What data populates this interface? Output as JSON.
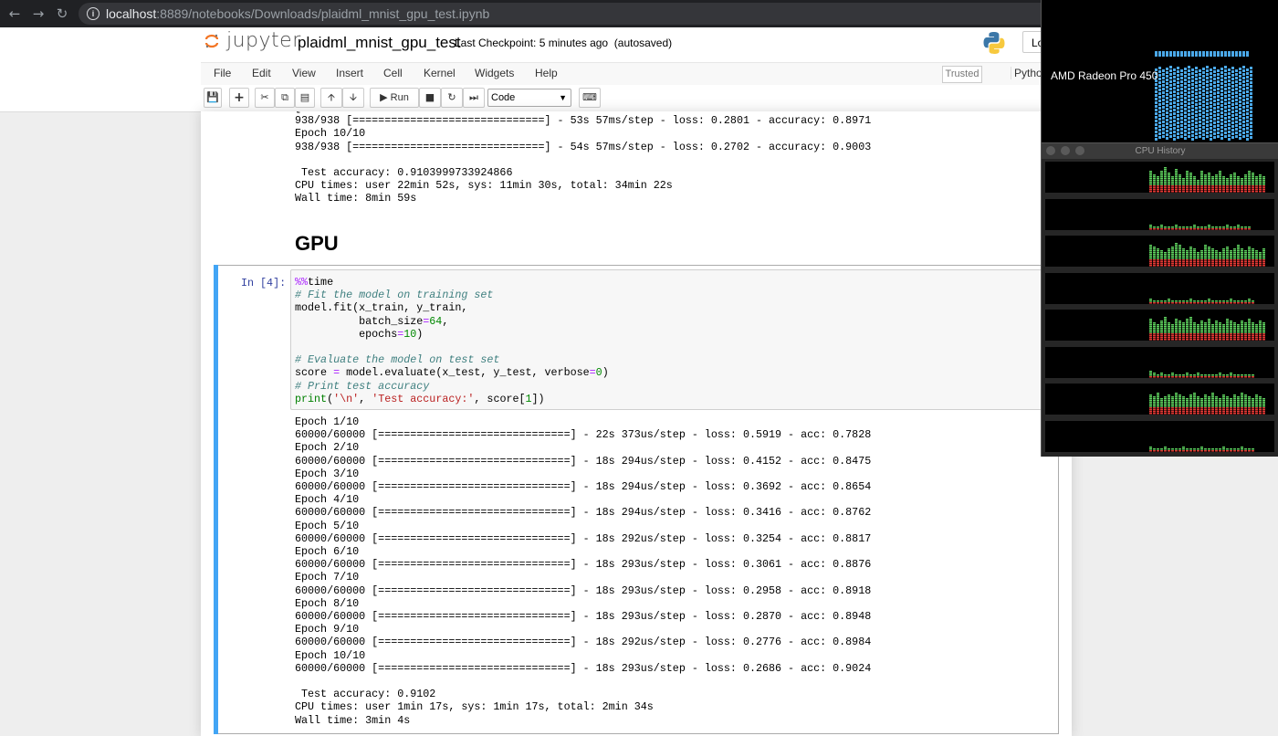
{
  "browser": {
    "url_host": "localhost",
    "url_path": ":8889/notebooks/Downloads/plaidml_mnist_gpu_test.ipynb",
    "back_icon": "back-arrow-icon",
    "forward_icon": "forward-arrow-icon",
    "reload_icon": "reload-icon"
  },
  "header": {
    "logo_text": "jupyter",
    "notebook_title": "plaidml_mnist_gpu_test",
    "checkpoint": "Last Checkpoint: 5 minutes ago",
    "autosave": "(autosaved)",
    "logout": "Lo"
  },
  "menu": {
    "items": [
      "File",
      "Edit",
      "View",
      "Insert",
      "Cell",
      "Kernel",
      "Widgets",
      "Help"
    ],
    "trusted": "Trusted",
    "kernel": "Pytho"
  },
  "toolbar": {
    "run_label": "Run",
    "cell_type": "Code"
  },
  "previous_output": {
    "lines": [
      "938/938 [==============================] - 53s 57ms/step - loss: 0.2801 - accuracy: 0.8971",
      "Epoch 10/10",
      "938/938 [==============================] - 54s 57ms/step - loss: 0.2702 - accuracy: 0.9003",
      "",
      " Test accuracy: 0.9103999733924866",
      "CPU times: user 22min 52s, sys: 11min 30s, total: 34min 22s",
      "Wall time: 8min 59s"
    ]
  },
  "gpu_heading": "GPU",
  "cell": {
    "prompt": "In [4]:",
    "code": {
      "l1_magic": "%%",
      "l1_rest": "time",
      "l2": "# Fit the model on training set",
      "l3": "model.fit(x_train, y_train,",
      "l4_a": "          batch_size",
      "l4_eq": "=",
      "l4_num": "64",
      "l4_end": ",",
      "l5_a": "          epochs",
      "l5_eq": "=",
      "l5_num": "10",
      "l5_end": ")",
      "l7": "# Evaluate the model on test set",
      "l8_a": "score ",
      "l8_eq": "=",
      "l8_b": " model.evaluate(x_test, y_test, verbose",
      "l8_eq2": "=",
      "l8_num": "0",
      "l8_end": ")",
      "l9": "# Print test accuracy",
      "l10_fn": "print",
      "l10_a": "(",
      "l10_s1": "'\\n'",
      "l10_b": ", ",
      "l10_s2": "'Test accuracy:'",
      "l10_c": ", score[",
      "l10_num": "1",
      "l10_d": "])"
    },
    "output_lines": [
      "Epoch 1/10",
      "60000/60000 [==============================] - 22s 373us/step - loss: 0.5919 - acc: 0.7828",
      "Epoch 2/10",
      "60000/60000 [==============================] - 18s 294us/step - loss: 0.4152 - acc: 0.8475",
      "Epoch 3/10",
      "60000/60000 [==============================] - 18s 294us/step - loss: 0.3692 - acc: 0.8654",
      "Epoch 4/10",
      "60000/60000 [==============================] - 18s 294us/step - loss: 0.3416 - acc: 0.8762",
      "Epoch 5/10",
      "60000/60000 [==============================] - 18s 292us/step - loss: 0.3254 - acc: 0.8817",
      "Epoch 6/10",
      "60000/60000 [==============================] - 18s 293us/step - loss: 0.3061 - acc: 0.8876",
      "Epoch 7/10",
      "60000/60000 [==============================] - 18s 293us/step - loss: 0.2958 - acc: 0.8918",
      "Epoch 8/10",
      "60000/60000 [==============================] - 18s 293us/step - loss: 0.2870 - acc: 0.8948",
      "Epoch 9/10",
      "60000/60000 [==============================] - 18s 292us/step - loss: 0.2776 - acc: 0.8984",
      "Epoch 10/10",
      "60000/60000 [==============================] - 18s 293us/step - loss: 0.2686 - acc: 0.9024",
      "",
      " Test accuracy: 0.9102",
      "CPU times: user 1min 17s, sys: 1min 17s, total: 2min 34s",
      "Wall time: 3min 4s"
    ]
  },
  "gpu_monitor": {
    "device_name": "AMD Radeon Pro 450",
    "bar_color": "#4aa8e8"
  },
  "cpu_history": {
    "title": "CPU History",
    "user_color": "#5fd35f",
    "system_color": "#e53935"
  },
  "colors": {
    "selected_cell": "#42a5f5",
    "prompt": "#303f9f"
  }
}
